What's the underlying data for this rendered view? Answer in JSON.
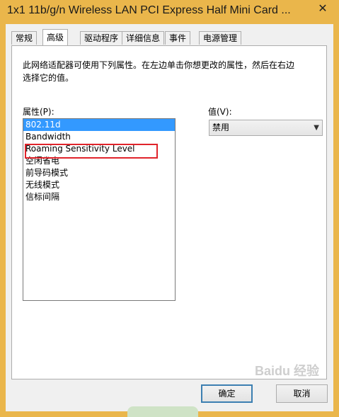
{
  "window": {
    "title": "1x1 11b/g/n Wireless LAN PCI Express Half Mini Card ...",
    "close_glyph": "✕"
  },
  "tabs": [
    {
      "label": "常规",
      "active": false
    },
    {
      "label": "高级",
      "active": true
    },
    {
      "label": "驱动程序",
      "active": false
    },
    {
      "label": "详细信息",
      "active": false
    },
    {
      "label": "事件",
      "active": false
    },
    {
      "label": "电源管理",
      "active": false
    }
  ],
  "advanced": {
    "description": "此网络适配器可使用下列属性。在左边单击你想更改的属性，然后在右边选择它的值。",
    "property_label": "属性(P):",
    "value_label": "值(V):",
    "properties": [
      "802.11d",
      "Bandwidth",
      "Roaming Sensitivity Level",
      "空闲省电",
      "前导码模式",
      "无线模式",
      "信标间隔"
    ],
    "selected_index": 0,
    "highlighted_index": 2,
    "highlight_color": "#e0242b",
    "value_selected": "禁用"
  },
  "buttons": {
    "ok": "确定",
    "cancel": "取消"
  },
  "watermark": "Baidu 经验"
}
